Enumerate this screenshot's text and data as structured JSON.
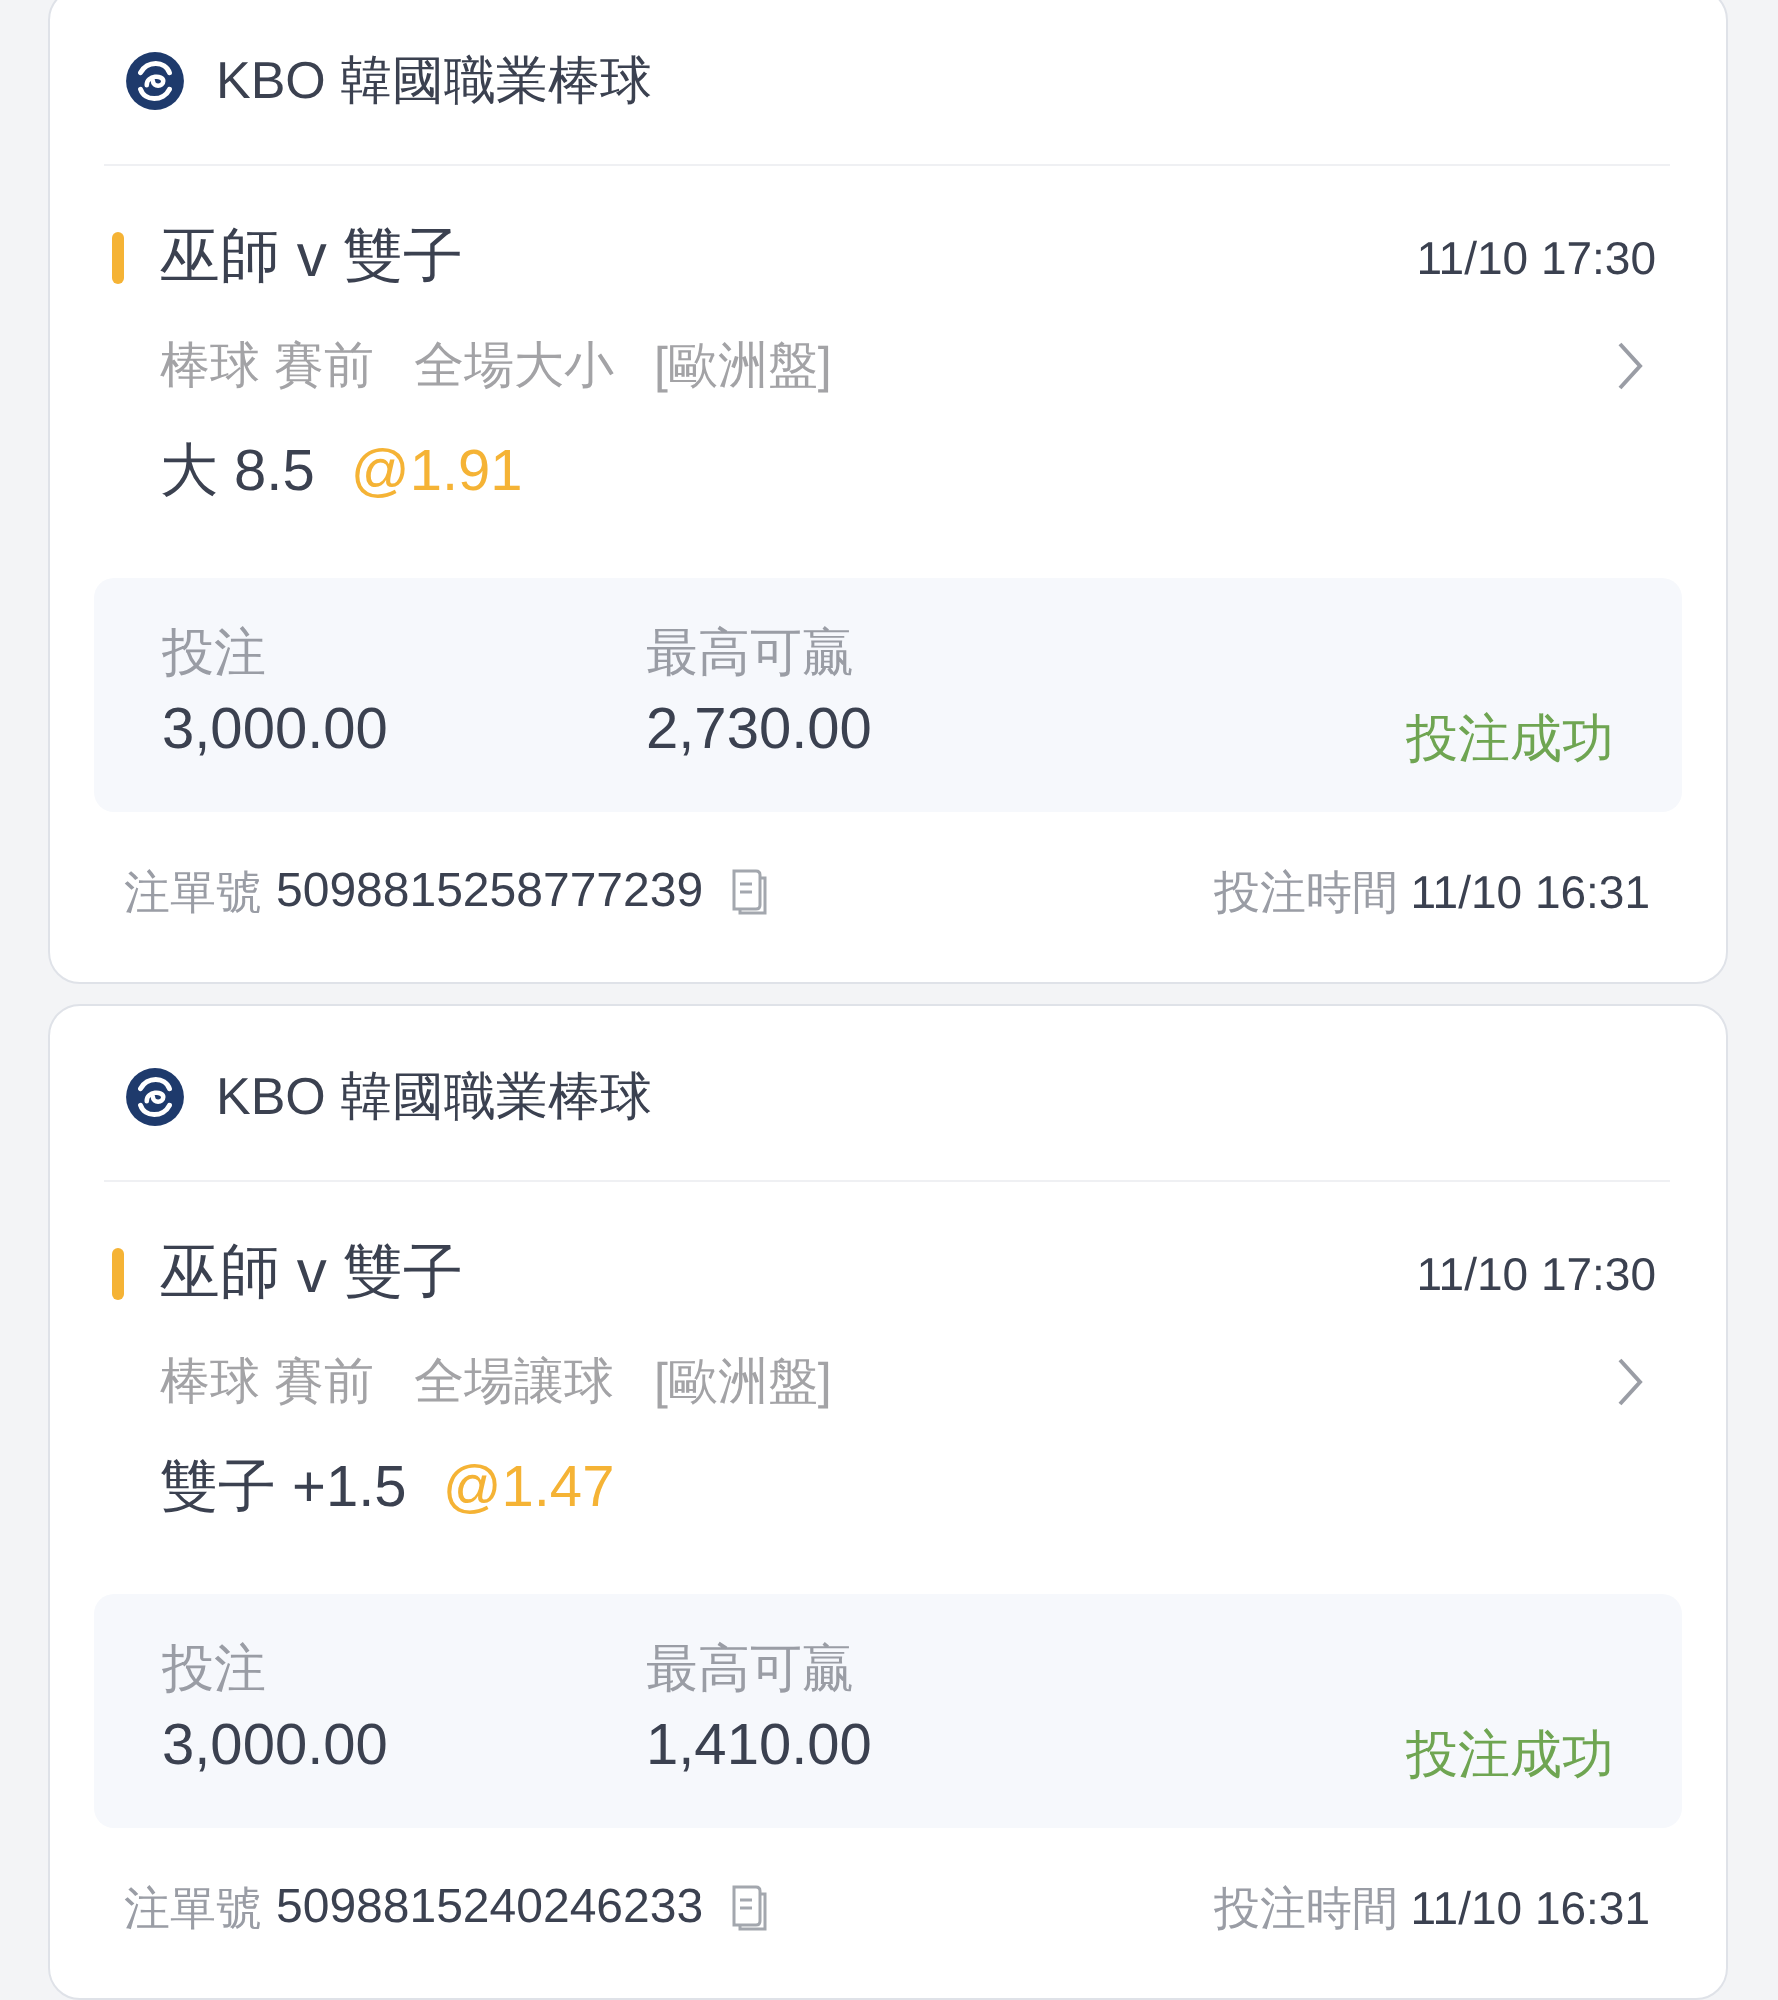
{
  "bets": [
    {
      "league": "KBO 韓國職業棒球",
      "match": "巫師 v 雙子",
      "start_time": "11/10 17:30",
      "market": [
        "棒球 賽前",
        "全場大小",
        "[歐洲盤]"
      ],
      "selection": "大 8.5",
      "odds": "@1.91",
      "stake_label": "投注",
      "stake": "3,000.00",
      "payout_label": "最高可贏",
      "payout": "2,730.00",
      "status": "投注成功",
      "ticket_label": "注單號",
      "ticket_no": "5098815258777239",
      "time_label": "投注時間",
      "bet_time": "11/10 16:31"
    },
    {
      "league": "KBO 韓國職業棒球",
      "match": "巫師 v 雙子",
      "start_time": "11/10 17:30",
      "market": [
        "棒球 賽前",
        "全場讓球",
        "[歐洲盤]"
      ],
      "selection": "雙子 +1.5",
      "odds": "@1.47",
      "stake_label": "投注",
      "stake": "3,000.00",
      "payout_label": "最高可贏",
      "payout": "1,410.00",
      "status": "投注成功",
      "ticket_label": "注單號",
      "ticket_no": "5098815240246233",
      "time_label": "投注時間",
      "bet_time": "11/10 16:31"
    }
  ]
}
